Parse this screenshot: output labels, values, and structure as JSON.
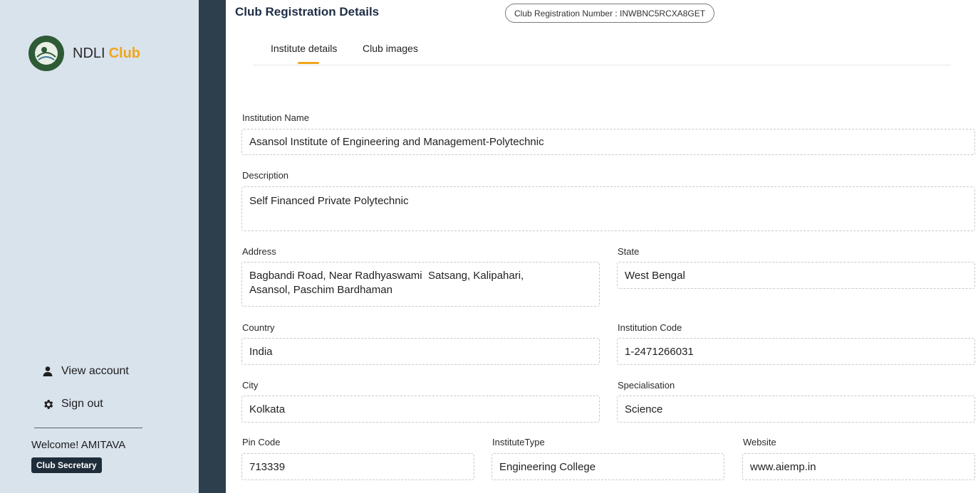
{
  "brand": {
    "name": "NDLI",
    "accent": "Club",
    "accent_color": "#f1a51d"
  },
  "sidebar": {
    "view_account": "View account",
    "sign_out": "Sign out",
    "welcome_prefix": "Welcome!",
    "username": "AMITAVA",
    "role": "Club Secretary"
  },
  "header": {
    "title": "Club Registration Details",
    "registration_number": "Club Registration Number : INWBNC5RCXA8GET"
  },
  "tabs": [
    {
      "label": "Institute details",
      "active": true
    },
    {
      "label": "Club images",
      "active": false
    }
  ],
  "form": {
    "institution_name": {
      "label": "Institution Name",
      "value": "Asansol Institute of Engineering and Management-Polytechnic"
    },
    "description": {
      "label": "Description",
      "value": "Self Financed Private Polytechnic"
    },
    "address": {
      "label": "Address",
      "value": "Bagbandi Road, Near Radhyaswami  Satsang, Kalipahari,\nAsansol, Paschim Bardhaman"
    },
    "state": {
      "label": "State",
      "value": "West Bengal"
    },
    "country": {
      "label": "Country",
      "value": "India"
    },
    "institution_code": {
      "label": "Institution Code",
      "value": "1-2471266031"
    },
    "city": {
      "label": "City",
      "value": "Kolkata"
    },
    "specialisation": {
      "label": "Specialisation",
      "value": "Science"
    },
    "pin_code": {
      "label": "Pin Code",
      "value": "713339"
    },
    "institute_type": {
      "label": "InstituteType",
      "value": "Engineering College"
    },
    "website": {
      "label": "Website",
      "value": "www.aiemp.in"
    }
  },
  "icons": {
    "account": "person-icon",
    "sign_out": "gear-icon",
    "logo": "ndli-logo-icon"
  }
}
